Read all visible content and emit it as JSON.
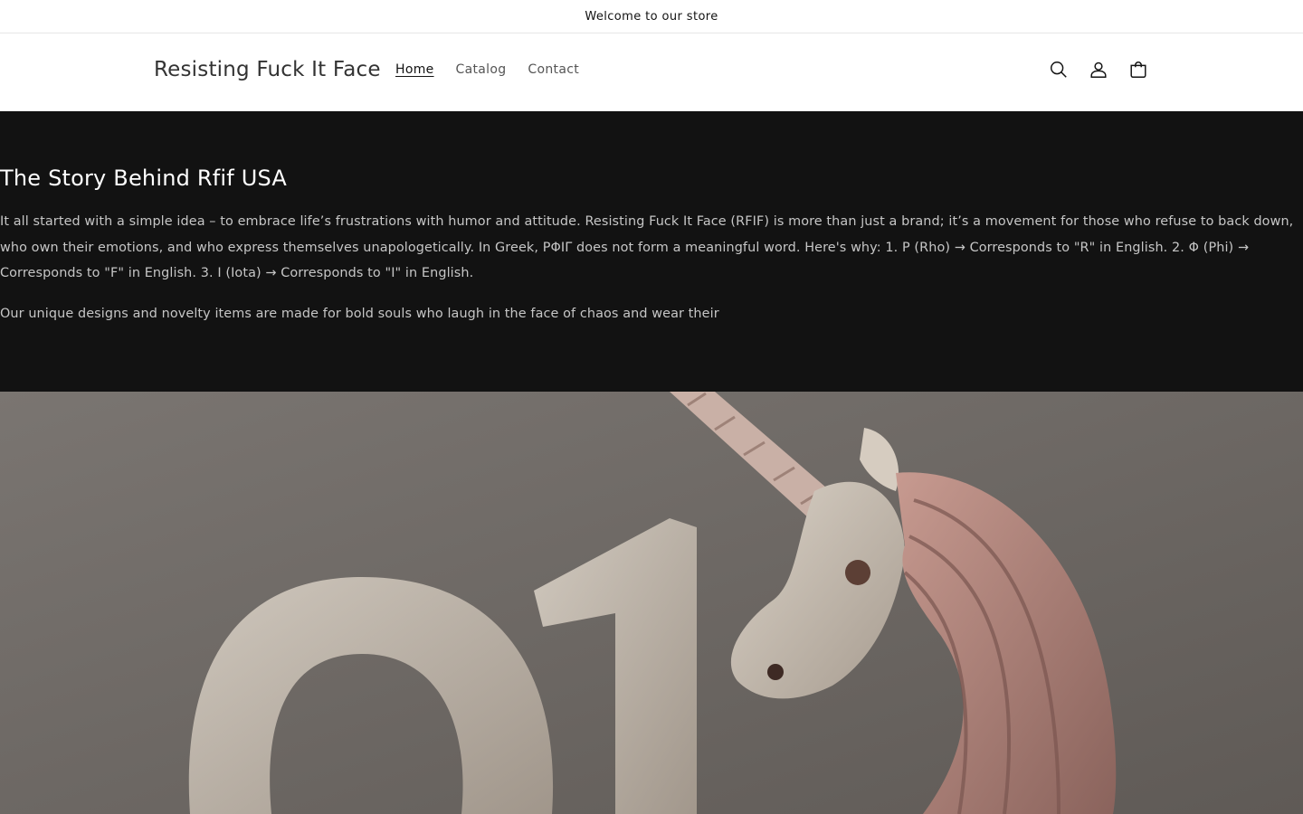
{
  "announcement": {
    "text": "Welcome to our store"
  },
  "header": {
    "logo": "Resisting Fuck It Face",
    "nav": [
      {
        "label": "Home",
        "active": true
      },
      {
        "label": "Catalog",
        "active": false
      },
      {
        "label": "Contact",
        "active": false
      }
    ],
    "icons": [
      "search-icon",
      "account-icon",
      "cart-icon"
    ]
  },
  "story": {
    "heading": "The Story Behind Rfif USA",
    "paragraph_1": "It all started with a simple idea – to embrace life’s frustrations with humor and attitude. Resisting Fuck It Face (RFIF) is more than just a brand; it’s a movement for those who refuse to back down, who own their emotions, and who express themselves unapologetically. In Greek, ΡΦΙΓ does not form a meaningful word. Here's why: 1. Ρ (Rho) → Corresponds to \"R\" in English. 2. Φ (Phi) → Corresponds to \"F\" in English. 3. Ι (Iota) → Corresponds to \"I\" in English.",
    "paragraph_2": "Our unique designs and novelty items are made for bold souls who laugh in the face of chaos and wear their"
  },
  "hero": {
    "image": "unicorn-sculpture-image"
  },
  "colors": {
    "dark_band": "#121212",
    "hero_bg": "#6f6a66",
    "accent_pink": "#b98a80"
  }
}
